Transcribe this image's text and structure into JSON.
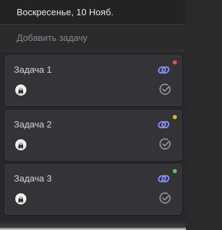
{
  "header": {
    "date": "Воскресенье, 10 Нояб."
  },
  "add_task": {
    "placeholder": "Добавить задачу",
    "value": ""
  },
  "tasks": [
    {
      "title": "Задача 1",
      "priority_color": "#e5534b",
      "link_icon": "link-icon",
      "check_icon": "check-circle-icon"
    },
    {
      "title": "Задача 2",
      "priority_color": "#e6b422",
      "link_icon": "link-icon",
      "check_icon": "check-circle-icon"
    },
    {
      "title": "Задача 3",
      "priority_color": "#5bbf67",
      "link_icon": "link-icon",
      "check_icon": "check-circle-icon"
    }
  ],
  "colors": {
    "link_icon": "#8a8ff0",
    "check_icon": "#9a9aa0"
  }
}
